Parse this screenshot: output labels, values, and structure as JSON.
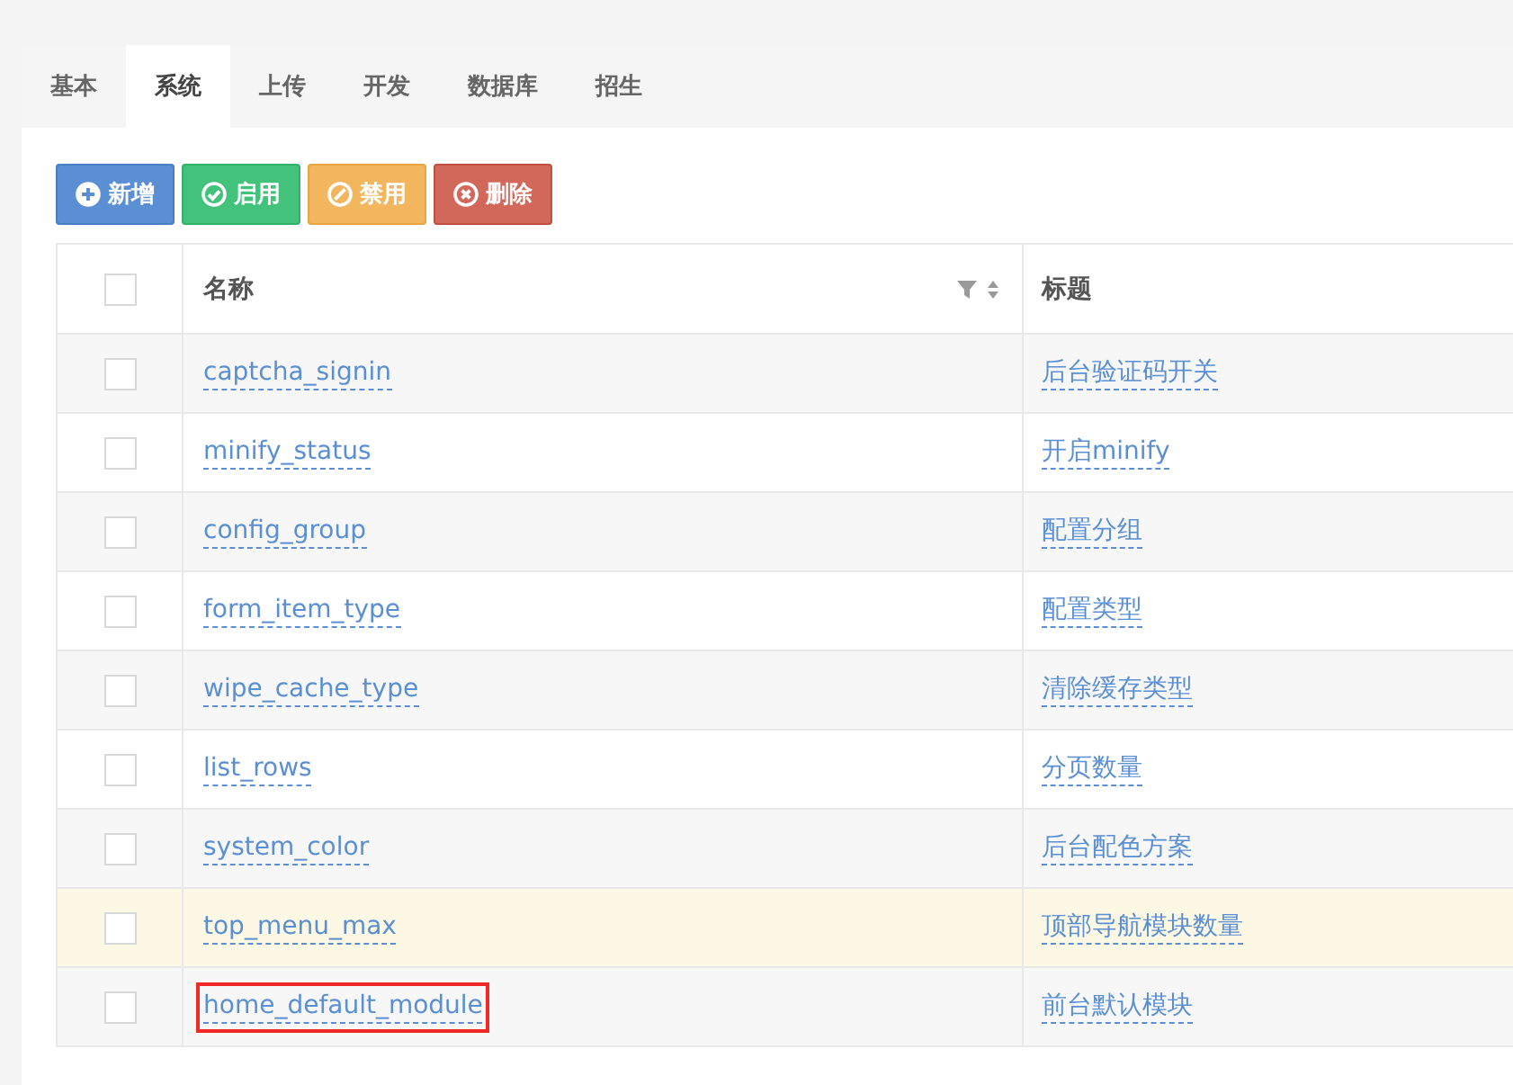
{
  "tabs": [
    {
      "label": "基本",
      "selected": false
    },
    {
      "label": "系统",
      "selected": true
    },
    {
      "label": "上传",
      "selected": false
    },
    {
      "label": "开发",
      "selected": false
    },
    {
      "label": "数据库",
      "selected": false
    },
    {
      "label": "招生",
      "selected": false
    }
  ],
  "toolbar": [
    {
      "kind": "add",
      "label": "新增"
    },
    {
      "kind": "enable",
      "label": "启用"
    },
    {
      "kind": "disable",
      "label": "禁用"
    },
    {
      "kind": "delete",
      "label": "删除"
    }
  ],
  "table": {
    "select_all_checked": false,
    "columns": [
      "名称",
      "标题"
    ],
    "rows": [
      {
        "name": "captcha_signin",
        "title": "后台验证码开关",
        "checked": false,
        "highlighted": false,
        "annotated": false
      },
      {
        "name": "minify_status",
        "title": "开启minify",
        "checked": false,
        "highlighted": false,
        "annotated": false
      },
      {
        "name": "config_group",
        "title": "配置分组",
        "checked": false,
        "highlighted": false,
        "annotated": false
      },
      {
        "name": "form_item_type",
        "title": "配置类型",
        "checked": false,
        "highlighted": false,
        "annotated": false
      },
      {
        "name": "wipe_cache_type",
        "title": "清除缓存类型",
        "checked": false,
        "highlighted": false,
        "annotated": false
      },
      {
        "name": "list_rows",
        "title": "分页数量",
        "checked": false,
        "highlighted": false,
        "annotated": false
      },
      {
        "name": "system_color",
        "title": "后台配色方案",
        "checked": false,
        "highlighted": false,
        "annotated": false
      },
      {
        "name": "top_menu_max",
        "title": "顶部导航模块数量",
        "checked": false,
        "highlighted": true,
        "annotated": false
      },
      {
        "name": "home_default_module",
        "title": "前台默认模块",
        "checked": false,
        "highlighted": false,
        "annotated": true
      }
    ]
  }
}
